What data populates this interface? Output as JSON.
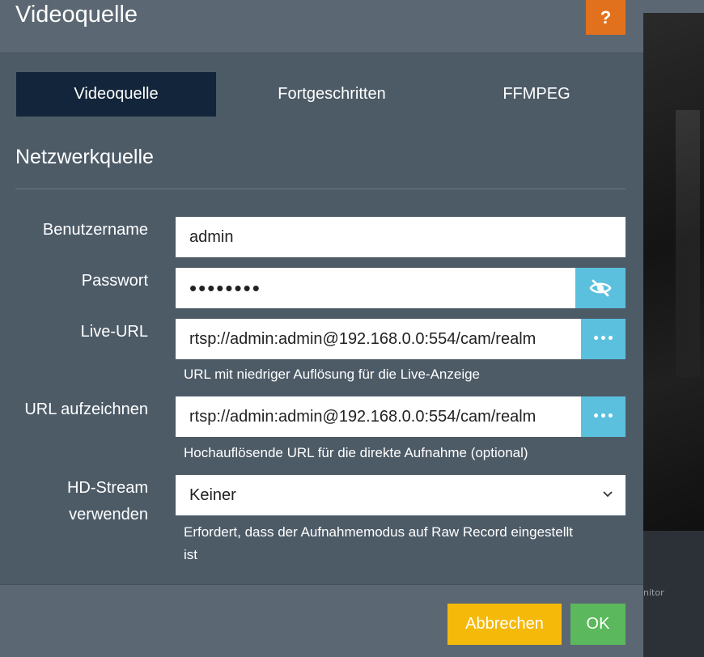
{
  "header": {
    "title": "Videoquelle",
    "help_label": "?"
  },
  "tabs": [
    {
      "label": "Videoquelle",
      "active": true
    },
    {
      "label": "Fortgeschritten",
      "active": false
    },
    {
      "label": "FFMPEG",
      "active": false
    }
  ],
  "section": {
    "title": "Netzwerkquelle"
  },
  "form": {
    "username": {
      "label": "Benutzername",
      "value": "admin"
    },
    "password": {
      "label": "Passwort",
      "value": "••••••••",
      "toggle_icon": "eye-slash-icon"
    },
    "live_url": {
      "label": "Live-URL",
      "value": "rtsp://admin:admin@192.168.0.0:554/cam/realm",
      "button_label": "•••",
      "help": "URL mit niedriger Auflösung für die Live-Anzeige"
    },
    "record_url": {
      "label": "URL aufzeichnen",
      "value": "rtsp://admin:admin@192.168.0.0:554/cam/realm",
      "button_label": "•••",
      "help": "Hochauflösende URL für die direkte Aufnahme (optional)"
    },
    "hd_stream": {
      "label_line1": "HD-Stream",
      "label_line2": "verwenden",
      "value": "Keiner",
      "help_line1": "Erfordert, dass der Aufnahmemodus auf Raw Record eingestellt",
      "help_line2": "ist"
    }
  },
  "footer": {
    "cancel_label": "Abbrechen",
    "ok_label": "OK"
  },
  "background": {
    "monitor_text": "nitor"
  },
  "colors": {
    "help_button": "#e2711d",
    "active_tab": "#13253a",
    "addon": "#5bc0de",
    "cancel": "#f5b90a",
    "ok": "#5cb85c"
  }
}
